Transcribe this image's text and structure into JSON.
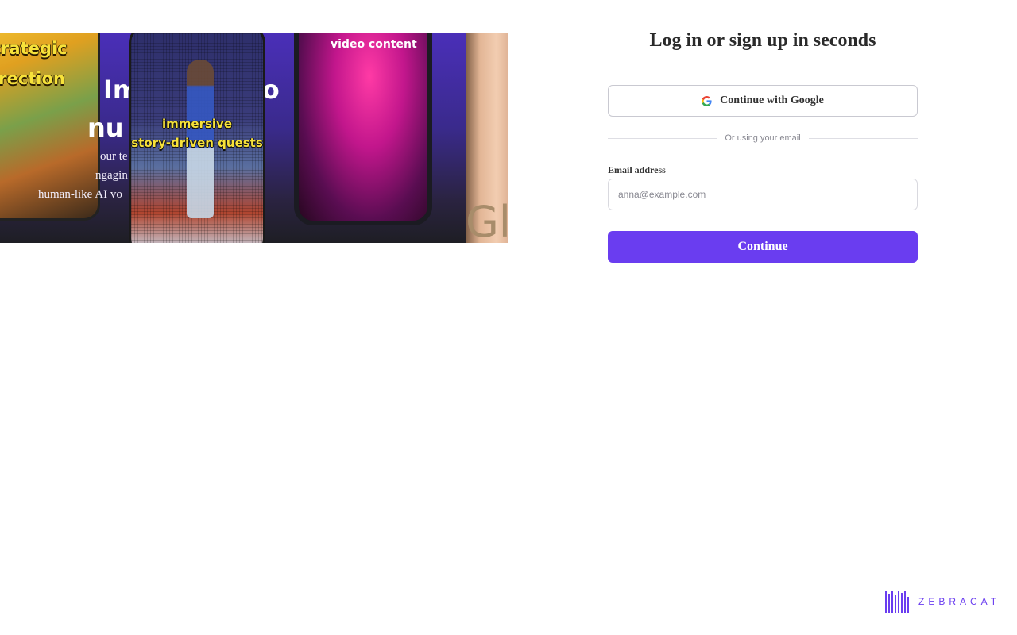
{
  "hero": {
    "tile_left_lines": [
      "trategic",
      "irection"
    ],
    "title_fragments": [
      "Im",
      "eo",
      "nu"
    ],
    "description_fragments": [
      "our te",
      "ngagin",
      "human-like AI vo"
    ],
    "tile_mid_caption_lines": [
      "immersive",
      "story-driven quests"
    ],
    "tile_phone_caption": "video content",
    "tile_face_fragment": "Gl"
  },
  "auth": {
    "heading": "Log in or sign up in seconds",
    "google_button_label": "Continue with Google",
    "divider_text": "Or using your email",
    "email_label": "Email address",
    "email_placeholder": "anna@example.com",
    "email_value": "",
    "continue_label": "Continue"
  },
  "brand": {
    "name": "ZEBRACAT",
    "color": "#6a3df0"
  },
  "icons": {
    "google": "google-icon",
    "brand_mark": "zebracat-logo-icon"
  }
}
